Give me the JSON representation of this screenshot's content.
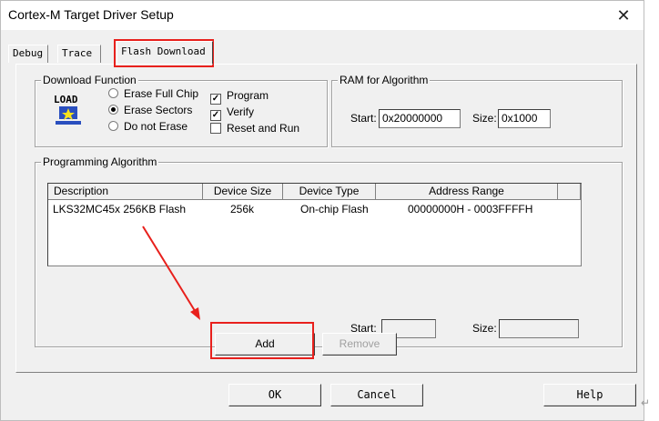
{
  "window": {
    "title": "Cortex-M Target Driver Setup"
  },
  "tabs": [
    {
      "label": "Debug"
    },
    {
      "label": "Trace"
    },
    {
      "label": "Flash Download"
    }
  ],
  "download_function": {
    "legend": "Download Function",
    "load_icon_text": "LOAD",
    "radios": [
      {
        "label": "Erase Full Chip",
        "selected": false
      },
      {
        "label": "Erase Sectors",
        "selected": true
      },
      {
        "label": "Do not Erase",
        "selected": false
      }
    ],
    "checks": [
      {
        "label": "Program",
        "checked": true,
        "mark": "✓"
      },
      {
        "label": "Verify",
        "checked": true,
        "mark": "✓"
      },
      {
        "label": "Reset and Run",
        "checked": false,
        "mark": ""
      }
    ]
  },
  "ram": {
    "legend": "RAM for Algorithm",
    "start_label": "Start:",
    "start_value": "0x20000000",
    "size_label": "Size:",
    "size_value": "0x1000"
  },
  "programming_algorithm": {
    "legend": "Programming Algorithm",
    "columns": [
      "Description",
      "Device Size",
      "Device Type",
      "Address Range"
    ],
    "rows": [
      [
        "LKS32MC45x 256KB Flash",
        "256k",
        "On-chip Flash",
        "00000000H - 0003FFFFH"
      ]
    ],
    "start_label": "Start:",
    "start_value": "",
    "size_label": "Size:",
    "size_value": ""
  },
  "buttons": {
    "add": "Add",
    "remove": "Remove",
    "ok": "OK",
    "cancel": "Cancel",
    "help": "Help"
  },
  "close_glyph": "✕",
  "return_glyph": "↵",
  "highlight_color": "#e8201c"
}
